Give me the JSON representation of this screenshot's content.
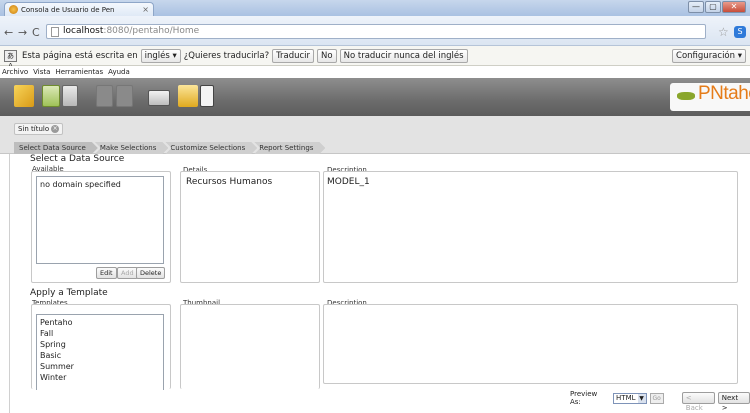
{
  "browser": {
    "tab_title": "Consola de Usuario de Pen",
    "tab_close": "×",
    "controls": {
      "minimize": "—",
      "maximize": "▢",
      "close": "✕"
    },
    "address": {
      "host": "localhost",
      "path": ":8080/pentaho/Home"
    },
    "translate": {
      "prefix": "Esta página está escrita en",
      "language": "inglés ▾",
      "question": "¿Quieres traducirla?",
      "translate_label": "Traducir",
      "no_label": "No",
      "never_label": "No traducir nunca del inglés",
      "config_label": "Configuración ▾"
    }
  },
  "menu": [
    "Archivo",
    "Vista",
    "Herramientas",
    "Ayuda"
  ],
  "toolbar_icons": [
    "new-report-icon",
    "open-icon",
    "save-icon",
    "save-as-icon",
    "print-icon",
    "folder-icon",
    "table-icon"
  ],
  "logo": {
    "text": "PNtaho"
  },
  "doc_tab": {
    "label": "Sin título"
  },
  "steps": [
    "Select Data Source",
    "Make Selections",
    "Customize Selections",
    "Report Settings"
  ],
  "data_source": {
    "title": "Select a Data Source",
    "available_label": "Available",
    "available_items": [
      "no domain specified"
    ],
    "buttons": {
      "edit": "Edit",
      "add": "Add",
      "delete": "Delete"
    },
    "details_label": "Details",
    "details_value": "Recursos Humanos",
    "description_label": "Description",
    "description_value": "MODEL_1"
  },
  "template": {
    "title": "Apply a Template",
    "templates_label": "Templates",
    "templates": [
      "Pentaho",
      "Fall",
      "Spring",
      "Basic",
      "Summer",
      "Winter"
    ],
    "thumbnail_label": "Thumbnail",
    "description_label": "Description"
  },
  "footer": {
    "preview_label": "Preview As:",
    "format": "HTML",
    "go_label": "Go",
    "back_label": "< Back",
    "next_label": "Next >"
  }
}
